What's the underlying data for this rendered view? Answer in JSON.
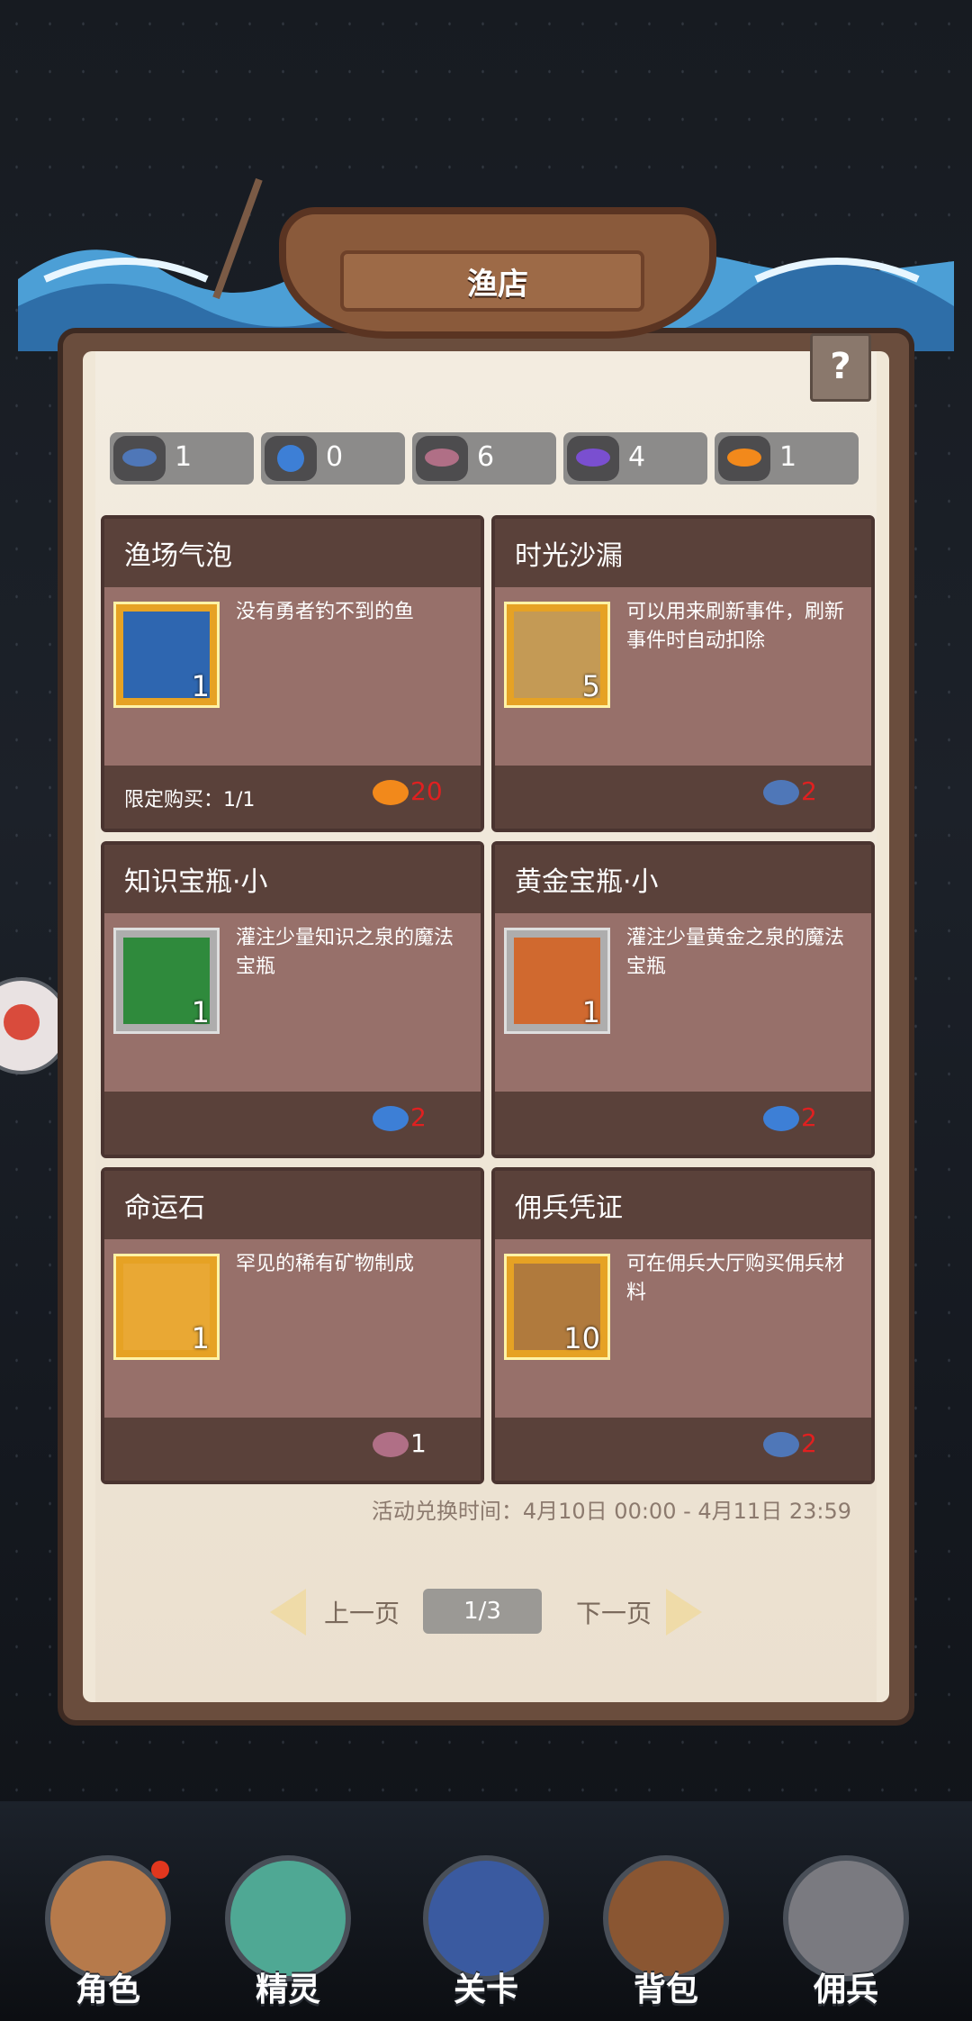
{
  "shop": {
    "title": "渔店",
    "help_label": "?"
  },
  "currencies": [
    {
      "icon": "tuna-icon",
      "value": "1"
    },
    {
      "icon": "pufferfish-icon",
      "value": "0"
    },
    {
      "icon": "piranha-icon",
      "value": "6"
    },
    {
      "icon": "shark-icon",
      "value": "4"
    },
    {
      "icon": "goldfish-icon",
      "value": "1"
    }
  ],
  "items": [
    {
      "title": "渔场气泡",
      "desc": "没有勇者钓不到的鱼",
      "qty": "1",
      "limit": "限定购买：1/1",
      "price": "20",
      "price_icon": "goldfish-icon"
    },
    {
      "title": "时光沙漏",
      "desc": "可以用来刷新事件，刷新事件时自动扣除",
      "qty": "5",
      "limit": "",
      "price": "2",
      "price_icon": "tuna-icon"
    },
    {
      "title": "知识宝瓶·小",
      "desc": "灌注少量知识之泉的魔法宝瓶",
      "qty": "1",
      "limit": "",
      "price": "2",
      "price_icon": "pufferfish-icon"
    },
    {
      "title": "黄金宝瓶·小",
      "desc": "灌注少量黄金之泉的魔法宝瓶",
      "qty": "1",
      "limit": "",
      "price": "2",
      "price_icon": "pufferfish-icon"
    },
    {
      "title": "命运石",
      "desc": "罕见的稀有矿物制成",
      "qty": "1",
      "limit": "",
      "price": "1",
      "price_icon": "piranha-icon"
    },
    {
      "title": "佣兵凭证",
      "desc": "可在佣兵大厅购买佣兵材料",
      "qty": "10",
      "limit": "",
      "price": "2",
      "price_icon": "tuna-icon"
    }
  ],
  "event_time": "活动兑换时间：4月10日 00:00 - 4月11日 23:59",
  "pager": {
    "prev": "上一页",
    "next": "下一页",
    "indicator": "1/3"
  },
  "nav": [
    {
      "label": "角色"
    },
    {
      "label": "精灵"
    },
    {
      "label": "关卡"
    },
    {
      "label": "背包"
    },
    {
      "label": "佣兵"
    }
  ],
  "colors": {
    "price_red": "#e02020",
    "card_bg": "#97706a",
    "card_header": "#5a413a",
    "gold_frame": "#e6a224"
  }
}
